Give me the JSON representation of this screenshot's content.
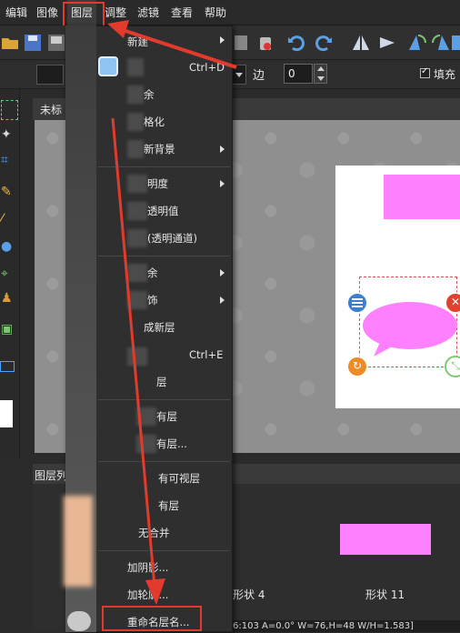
{
  "menubar": {
    "items": [
      "编辑",
      "图像",
      "图层",
      "调整",
      "滤镜",
      "查看",
      "帮助"
    ]
  },
  "options_bar": {
    "edge_label": "边",
    "edge_value": "0",
    "fill_label": "填充"
  },
  "document": {
    "tab_title": "未标"
  },
  "layers_panel": {
    "title": "图层列",
    "layer_labels": [
      "形状 4",
      "形状 11"
    ]
  },
  "status": {
    "text": "6:103 A=0.0° W=76,H=48 W/H=1.583]"
  },
  "dropdown": {
    "items": [
      {
        "label": "新建",
        "submenu": true
      },
      {
        "label": "",
        "shortcut": "Ctrl+D"
      },
      {
        "label": "余"
      },
      {
        "label": "格化"
      },
      {
        "label": "新背景",
        "submenu": true
      },
      {
        "label": "明度",
        "submenu": true
      },
      {
        "label": "透明值"
      },
      {
        "label": "(透明通道)"
      },
      {
        "label": "余",
        "submenu": true
      },
      {
        "label": "饰",
        "submenu": true
      },
      {
        "label": "成新层"
      },
      {
        "label": "",
        "shortcut": "Ctrl+E"
      },
      {
        "label": "层"
      },
      {
        "label": "有层"
      },
      {
        "label": "有层..."
      },
      {
        "label": "有可视层"
      },
      {
        "label": "有层"
      },
      {
        "label": "无合并"
      },
      {
        "label": "加阴影..."
      },
      {
        "label": "加轮廓..."
      },
      {
        "label": "重命名层名..."
      }
    ]
  },
  "colors": {
    "accent_red": "#e23b2e",
    "shape_pink": "#ff80ff"
  }
}
